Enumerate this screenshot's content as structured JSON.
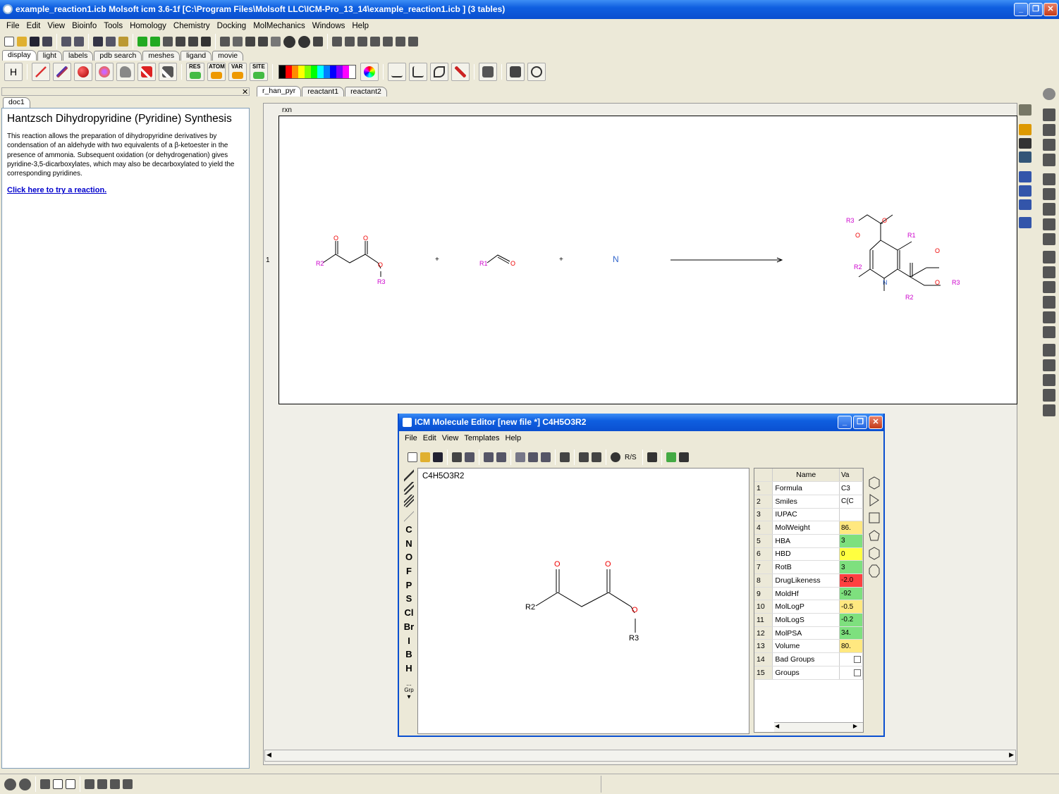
{
  "window": {
    "title": "example_reaction1.icb Molsoft icm 3.6-1f  [C:\\Program Files\\Molsoft LLC\\ICM-Pro_13_14\\example_reaction1.icb ] (3 tables)"
  },
  "menu": [
    "File",
    "Edit",
    "View",
    "Bioinfo",
    "Tools",
    "Homology",
    "Chemistry",
    "Docking",
    "MolMechanics",
    "Windows",
    "Help"
  ],
  "toolbar_tabs": [
    "display",
    "light",
    "labels",
    "pdb search",
    "meshes",
    "ligand",
    "movie"
  ],
  "toolbar2": {
    "h_label": "H",
    "res_label": "RES",
    "atom_label": "ATOM",
    "var_label": "VAR",
    "site_label": "SITE"
  },
  "palette_colors": [
    "#000000",
    "#ff0000",
    "#ff8c00",
    "#ffff00",
    "#80ff00",
    "#00ff00",
    "#00ffff",
    "#0080ff",
    "#0000ff",
    "#8000ff",
    "#ff00ff",
    "#ffffff"
  ],
  "left_panel": {
    "tab": "doc1",
    "heading": "Hantzsch Dihydropyridine (Pyridine) Synthesis",
    "body": "This reaction allows the preparation of dihydropyridine derivatives by condensation of an aldehyde with two equivalents of a β-ketoester in the presence of ammonia. Subsequent oxidation (or dehydrogenation) gives pyridine-3,5-dicarboxylates, which may also be decarboxylated to yield the corresponding pyridines.",
    "link": "Click here to try a reaction. "
  },
  "right_tabs": [
    "r_han_pyr",
    "reactant1",
    "reactant2"
  ],
  "reaction": {
    "column_header": "rxn",
    "row_number": "1",
    "plus": "+",
    "ammonia": "N",
    "labels": {
      "r1": "R1",
      "r2": "R2",
      "r3": "R3",
      "o": "O",
      "n": "N"
    }
  },
  "mol_editor": {
    "title": "ICM Molecule Editor [new file *] C4H5O3R2",
    "menu": [
      "File",
      "Edit",
      "View",
      "Templates",
      "Help"
    ],
    "rs_label": "R/S",
    "formula": "C4H5O3R2",
    "elements": [
      "C",
      "N",
      "O",
      "F",
      "P",
      "S",
      "Cl",
      "Br",
      "I",
      "B",
      "H"
    ],
    "grp_label": "Grp",
    "dots_label": "...",
    "grid_headers": {
      "name": "Name",
      "value": "Va"
    },
    "properties": [
      {
        "n": "1",
        "name": "Formula",
        "val": "C3",
        "color": "#ffffff"
      },
      {
        "n": "2",
        "name": "Smiles",
        "val": "C(C",
        "color": "#ffffff"
      },
      {
        "n": "3",
        "name": "IUPAC",
        "val": "",
        "color": "#ffffff"
      },
      {
        "n": "4",
        "name": "MolWeight",
        "val": "86.",
        "color": "#ffe880"
      },
      {
        "n": "5",
        "name": "HBA",
        "val": "3",
        "color": "#7ee07e"
      },
      {
        "n": "6",
        "name": "HBD",
        "val": "0",
        "color": "#ffff40"
      },
      {
        "n": "7",
        "name": "RotB",
        "val": "3",
        "color": "#7ee07e"
      },
      {
        "n": "8",
        "name": "DrugLikeness",
        "val": "-2.0",
        "color": "#ff4040"
      },
      {
        "n": "9",
        "name": "MoldHf",
        "val": "-92",
        "color": "#7ee07e"
      },
      {
        "n": "10",
        "name": "MolLogP",
        "val": "-0.5",
        "color": "#ffe880"
      },
      {
        "n": "11",
        "name": "MolLogS",
        "val": "-0.2",
        "color": "#7ee07e"
      },
      {
        "n": "12",
        "name": "MolPSA",
        "val": "34.",
        "color": "#7ee07e"
      },
      {
        "n": "13",
        "name": "Volume",
        "val": "80.",
        "color": "#ffe880"
      },
      {
        "n": "14",
        "name": "Bad Groups",
        "val": "",
        "color": "#ffffff"
      },
      {
        "n": "15",
        "name": "Groups",
        "val": "",
        "color": "#ffffff"
      }
    ]
  }
}
